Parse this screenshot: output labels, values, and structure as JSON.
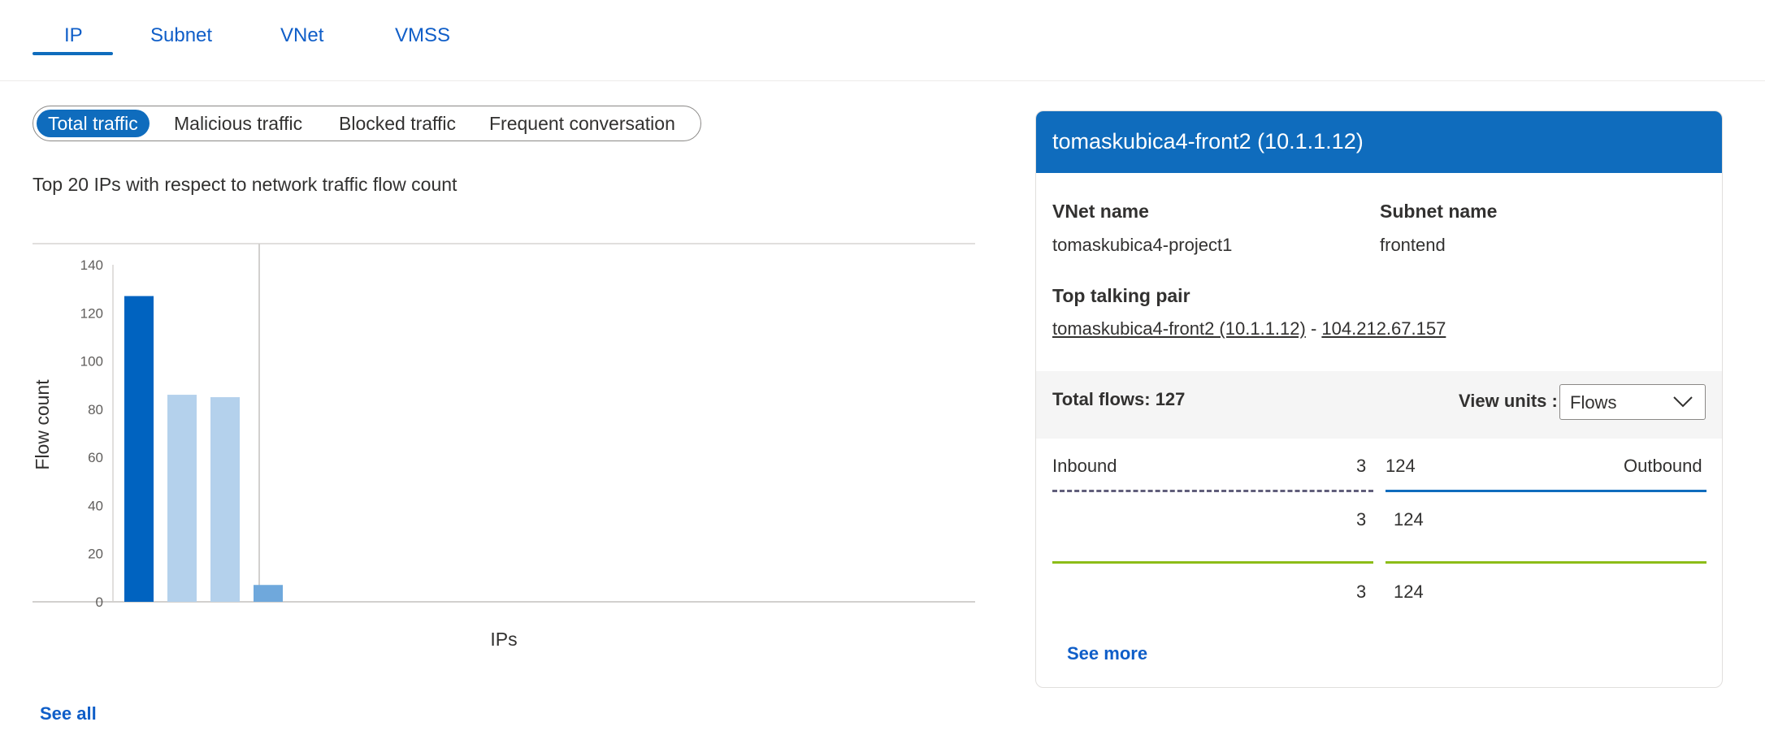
{
  "tabs": [
    {
      "label": "IP",
      "active": true
    },
    {
      "label": "Subnet",
      "active": false
    },
    {
      "label": "VNet",
      "active": false
    },
    {
      "label": "VMSS",
      "active": false
    }
  ],
  "filters": [
    {
      "label": "Total traffic",
      "active": true
    },
    {
      "label": "Malicious traffic",
      "active": false
    },
    {
      "label": "Blocked traffic",
      "active": false
    },
    {
      "label": "Frequent conversation",
      "active": false
    }
  ],
  "chart_caption": "Top 20 IPs with respect to network traffic flow count",
  "chart_data": {
    "type": "bar",
    "xlabel": "IPs",
    "ylabel": "Flow count",
    "ylim": [
      0,
      140
    ],
    "yticks": [
      "0",
      "20",
      "40",
      "60",
      "80",
      "100",
      "120",
      "140"
    ],
    "values": [
      127,
      86,
      85,
      7
    ],
    "selected_index": 0,
    "colors": {
      "selected": "#0063c0",
      "normal": "#b4d1ec",
      "hover": "#6fa8dc"
    },
    "hover_index": 3,
    "grid": false
  },
  "see_all_label": "See all",
  "card": {
    "title": "tomaskubica4-front2 (10.1.1.12)",
    "vnet_label": "VNet name",
    "vnet_value": "tomaskubica4-project1",
    "subnet_label": "Subnet name",
    "subnet_value": "frontend",
    "talking_pair_label": "Top talking pair",
    "pair_source": "tomaskubica4-front2 (10.1.1.12)",
    "pair_separator": " - ",
    "pair_dest": "104.212.67.157",
    "total_flows": "Total flows: 127",
    "view_units_label": "View units :",
    "view_units_value": "Flows",
    "inbound_label": "Inbound",
    "inbound_value": "3",
    "outbound_value": "124",
    "outbound_label": "Outbound",
    "rows": [
      {
        "inbound": "3",
        "outbound": "124"
      },
      {
        "inbound": "3",
        "outbound": "124"
      }
    ],
    "see_more_label": "See more",
    "colors": {
      "accent": "#0f6cbd",
      "green": "#8cbd18",
      "dashed": "#605e7a"
    }
  }
}
